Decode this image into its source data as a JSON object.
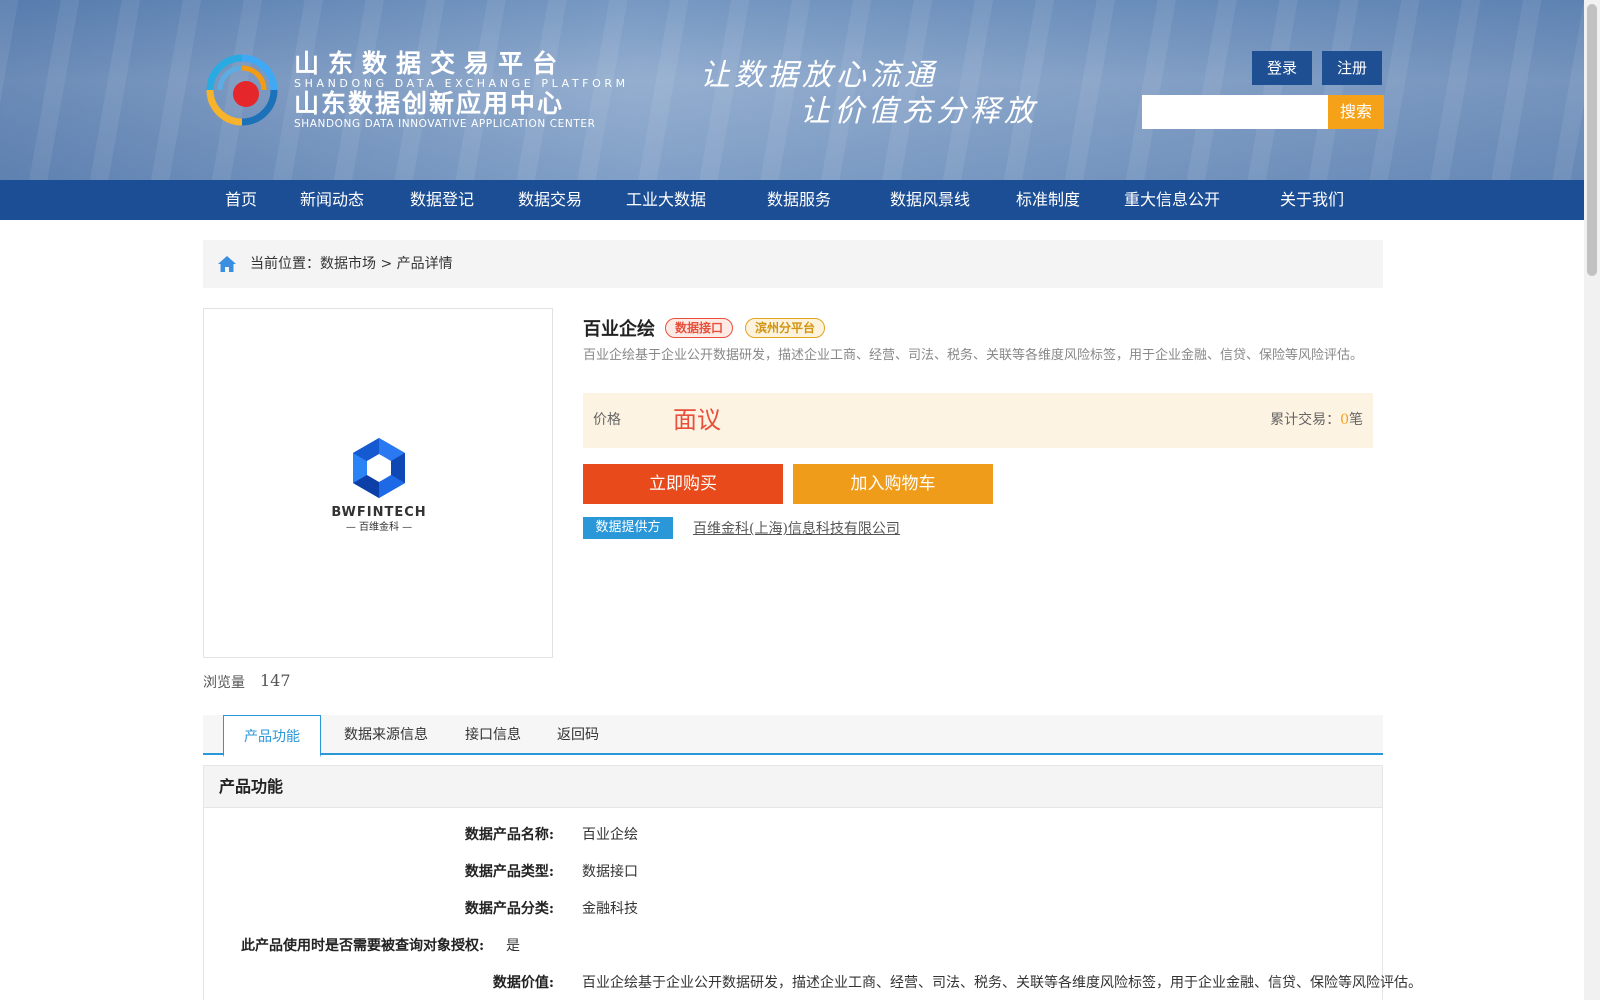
{
  "header": {
    "logo_cn_1": "山东数据交易平台",
    "logo_en_1": "SHANDONG DATA EXCHANGE PLATFORM",
    "logo_cn_2": "山东数据创新应用中心",
    "logo_en_2": "SHANDONG DATA INNOVATIVE APPLICATION CENTER",
    "slogan_1": "让数据放心流通",
    "slogan_2": "让价值充分释放",
    "login_label": "登录",
    "register_label": "注册",
    "search_placeholder": "",
    "search_label": "搜索"
  },
  "nav": {
    "items": [
      {
        "label": "首页"
      },
      {
        "label": "新闻动态"
      },
      {
        "label": "数据登记"
      },
      {
        "label": "数据交易"
      },
      {
        "label": "工业大数据"
      },
      {
        "label": "数据服务"
      },
      {
        "label": "数据风景线"
      },
      {
        "label": "标准制度"
      },
      {
        "label": "重大信息公开"
      },
      {
        "label": "关于我们"
      }
    ]
  },
  "breadcrumb": {
    "text": "当前位置：数据市场 > 产品详情"
  },
  "product": {
    "title": "百业企绘",
    "tag_type": "数据接口",
    "tag_platform": "滨州分平台",
    "description": "百业企绘基于企业公开数据研发，描述企业工商、经营、司法、税务、关联等各维度风险标签，用于企业金融、信贷、保险等风险评估。",
    "price_label": "价格",
    "price_value": "面议",
    "trades_label": "累计交易：",
    "trades_count": "0",
    "trades_unit": "笔",
    "buy_label": "立即购买",
    "cart_label": "加入购物车",
    "provider_label": "数据提供方",
    "provider_name": "百维金科(上海)信息科技有限公司",
    "views_label": "浏览量",
    "views_count": "147",
    "logo_text": "BWFINTECH",
    "logo_sub": "— 百维金科 —"
  },
  "tabs": [
    {
      "label": "产品功能"
    },
    {
      "label": "数据来源信息"
    },
    {
      "label": "接口信息"
    },
    {
      "label": "返回码"
    }
  ],
  "section": {
    "title": "产品功能",
    "rows": [
      {
        "key": "数据产品名称:",
        "value": "百业企绘"
      },
      {
        "key": "数据产品类型:",
        "value": "数据接口"
      },
      {
        "key": "数据产品分类:",
        "value": "金融科技"
      },
      {
        "key": "此产品使用时是否需要被查询对象授权:",
        "value": "是"
      },
      {
        "key": "数据价值:",
        "value": "百业企绘基于企业公开数据研发，描述企业工商、经营、司法、税务、关联等各维度风险标签，用于企业金融、信贷、保险等风险评估。"
      }
    ]
  },
  "colors": {
    "nav_bg": "#1c4e95",
    "accent_blue": "#2a97d8",
    "buy_red": "#e84a1b",
    "cart_orange": "#f09c1b",
    "price_red": "#e8503b"
  }
}
